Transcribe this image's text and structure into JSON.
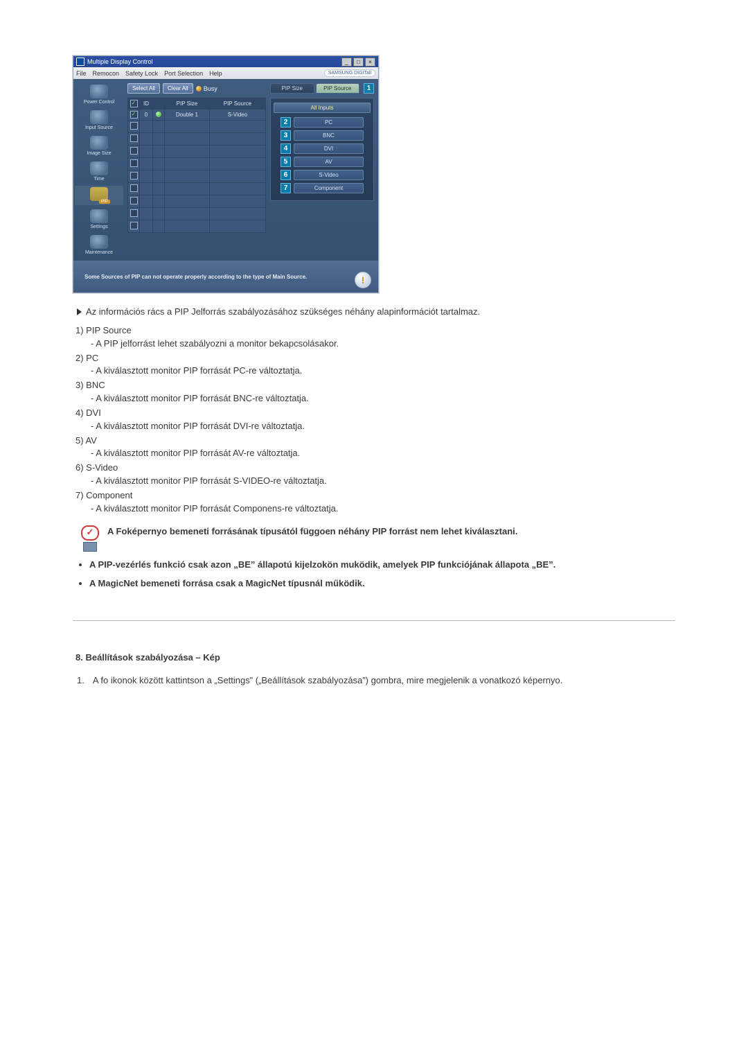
{
  "window": {
    "title": "Multiple Display Control",
    "brand": "SAMSUNG DIGITall"
  },
  "menu": {
    "file": "File",
    "remocon": "Remocon",
    "safety": "Safety Lock",
    "port": "Port Selection",
    "help": "Help"
  },
  "toolbar": {
    "select_all": "Select All",
    "clear_all": "Clear All",
    "busy": "Busy"
  },
  "sidebar": {
    "power": "Power Control",
    "input": "Input Source",
    "image": "Image Size",
    "time": "Time",
    "pip": "PIP",
    "settings": "Settings",
    "maintenance": "Maintenance"
  },
  "grid": {
    "h_chk": "",
    "h_id": "ID",
    "h_status": "",
    "h_pip_size": "PIP Size",
    "h_pip_source": "PIP Source",
    "row0_id": "0",
    "row0_size": "Double 1",
    "row0_src": "S-Video"
  },
  "right": {
    "tab_size": "PIP Size",
    "tab_source": "PIP Source",
    "all_inputs": "All Inputs",
    "pc": "PC",
    "bnc": "BNC",
    "dvi": "DVI",
    "av": "AV",
    "svideo": "S-Video",
    "component": "Component"
  },
  "callouts": {
    "n1": "1",
    "n2": "2",
    "n3": "3",
    "n4": "4",
    "n5": "5",
    "n6": "6",
    "n7": "7"
  },
  "footer_note": "Some Sources of PIP can not operate properly according to the type of Main Source.",
  "doc": {
    "lead": "Az információs rács a PIP Jelforrás szabályozásához szükséges néhány alapinformációt tartalmaz.",
    "i1_t": "1) PIP Source",
    "i1_s": "- A PIP jelforrást lehet szabályozni a monitor bekapcsolásakor.",
    "i2_t": "2) PC",
    "i2_s": "- A kiválasztott monitor PIP forrását PC-re változtatja.",
    "i3_t": "3) BNC",
    "i3_s": "- A kiválasztott monitor PIP forrását BNC-re változtatja.",
    "i4_t": "4) DVI",
    "i4_s": "- A kiválasztott monitor PIP forrását DVI-re változtatja.",
    "i5_t": "5) AV",
    "i5_s": "- A kiválasztott monitor PIP forrását AV-re változtatja.",
    "i6_t": "6) S-Video",
    "i6_s": "- A kiválasztott monitor PIP forrását S-VIDEO-re változtatja.",
    "i7_t": "7) Component",
    "i7_s": "- A kiválasztott monitor PIP forrását Componens-re változtatja.",
    "note": "A Foképernyo bemeneti forrásának típusától függoen néhány PIP forrást nem lehet kiválasztani.",
    "b1": "A PIP-vezérlés funkció csak azon „BE” állapotú kijelzokön muködik, amelyek PIP funkciójának állapota „BE”.",
    "b2": "A MagicNet bemeneti forrása csak a MagicNet típusnál működik.",
    "sect8_title": "8. Beállítások szabályozása – Kép",
    "sect8_num": "1.",
    "sect8_body": "A fo ikonok között kattintson a „Settings” („Beállítások szabályozása”) gombra, mire megjelenik a vonatkozó képernyo."
  }
}
